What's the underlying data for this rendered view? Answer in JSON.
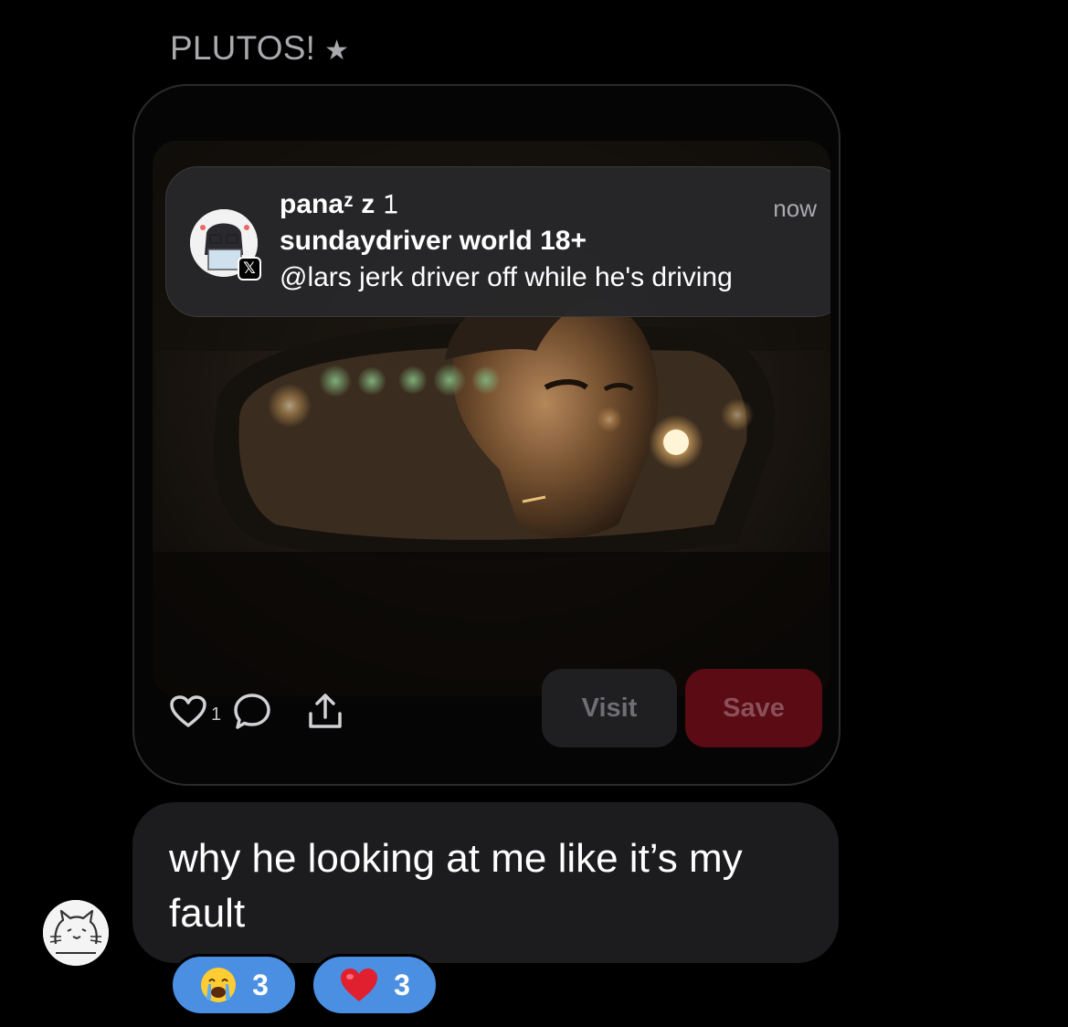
{
  "conversation": {
    "sender_name": "PLUTOS!",
    "sender_star": "★"
  },
  "shared_post": {
    "notification": {
      "author": "panaᶻ z 𝟷",
      "title": "sundaydriver world 18+",
      "text": "@lars jerk driver off while he's driving",
      "time": "now",
      "badge": "𝕏",
      "platform_icon": "x-logo-icon"
    },
    "image_description_icon": "photo-man-in-rearview-mirror",
    "actions": {
      "like_count": "1",
      "like_icon": "heart-icon",
      "comment_icon": "comment-icon",
      "share_icon": "share-icon"
    },
    "visit_label": "Visit",
    "save_label": "Save",
    "colors": {
      "save": "#5a0b14",
      "visit": "#1f1f21"
    }
  },
  "message": {
    "text": "why he looking at me like it’s my fault"
  },
  "reactions": [
    {
      "emoji_icon": "crying-face-icon",
      "count": "3"
    },
    {
      "emoji_icon": "red-heart-icon",
      "count": "3"
    }
  ],
  "colors": {
    "reaction_bg": "#4a8fe2",
    "bubble_bg": "#1c1c1e",
    "background": "#000000"
  }
}
